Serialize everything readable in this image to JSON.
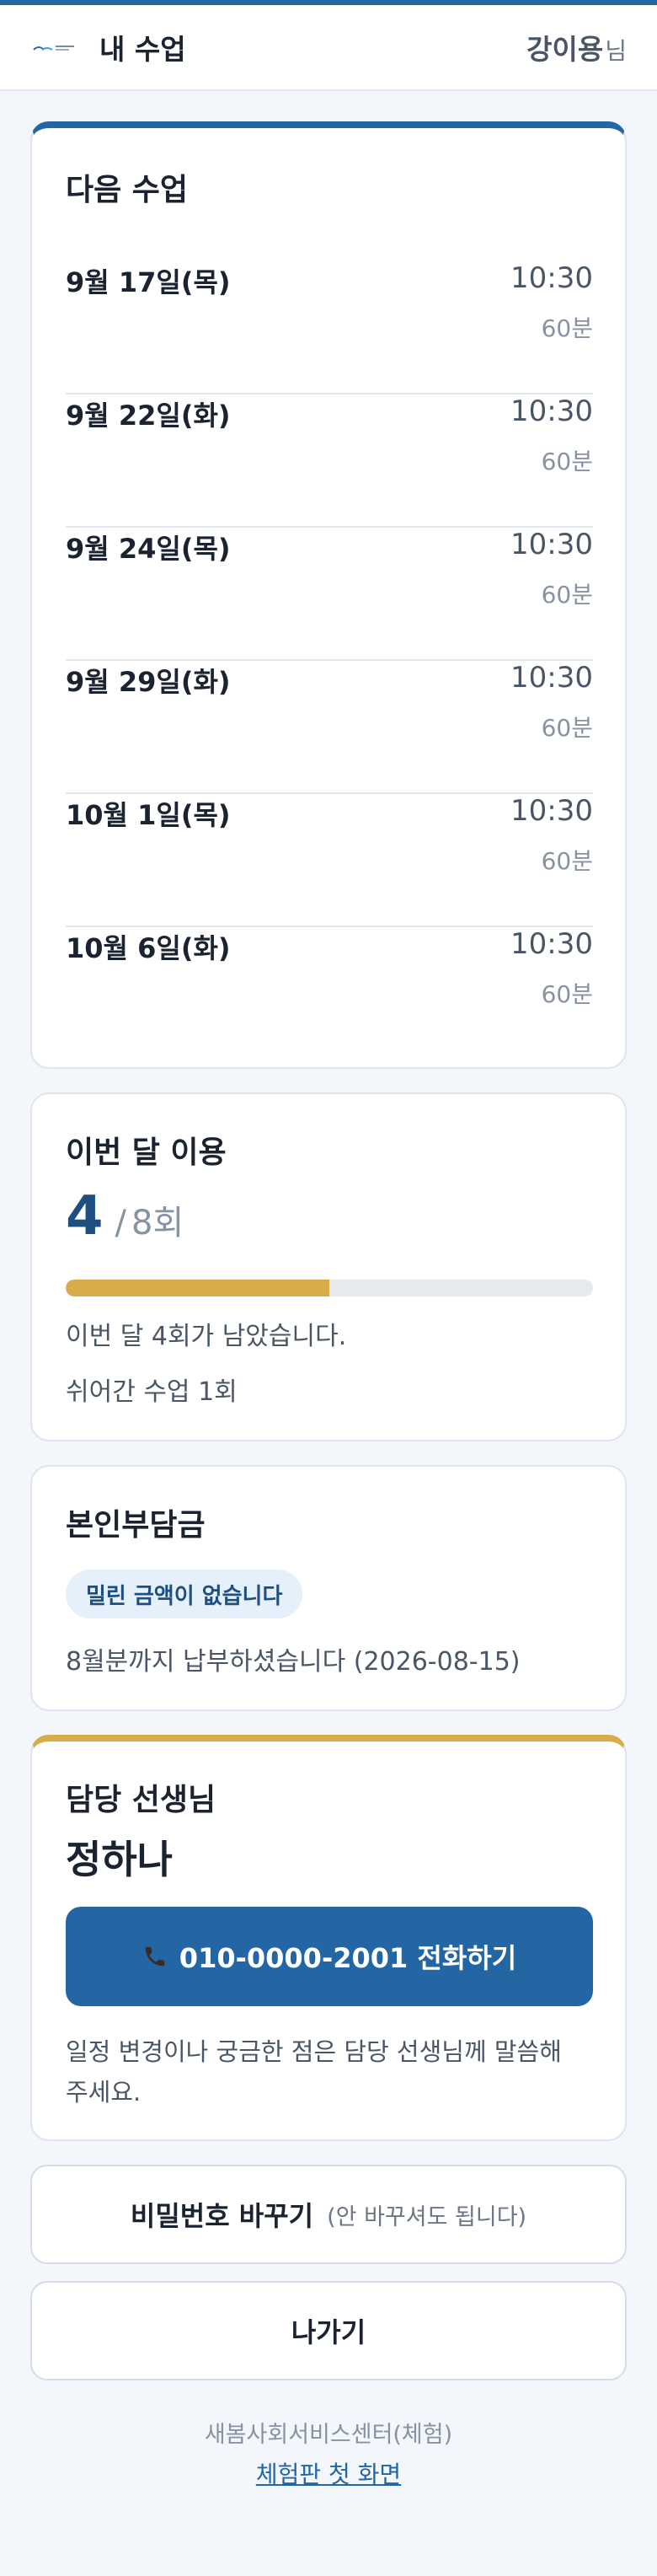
{
  "header": {
    "title": "내 수업",
    "user_name": "강이용",
    "user_suffix": "님",
    "logo_icon": "organization-logo-icon"
  },
  "next_classes": {
    "title": "다음 수업",
    "items": [
      {
        "date": "9월 17일(목)",
        "time": "10:30",
        "duration": "60분"
      },
      {
        "date": "9월 22일(화)",
        "time": "10:30",
        "duration": "60분"
      },
      {
        "date": "9월 24일(목)",
        "time": "10:30",
        "duration": "60분"
      },
      {
        "date": "9월 29일(화)",
        "time": "10:30",
        "duration": "60분"
      },
      {
        "date": "10월 1일(목)",
        "time": "10:30",
        "duration": "60분"
      },
      {
        "date": "10월 6일(화)",
        "time": "10:30",
        "duration": "60분"
      }
    ]
  },
  "usage": {
    "title": "이번 달 이용",
    "used": "4",
    "separator": "/",
    "total": "8회",
    "progress_fraction": 0.5,
    "remaining_text": "이번 달 4회가 남았습니다.",
    "skipped_text": "쉬어간 수업 1회"
  },
  "copay": {
    "title": "본인부담금",
    "badge": "밀린 금액이 없습니다",
    "paid_text": "8월분까지 납부하셨습니다 (2026-08-15)"
  },
  "teacher": {
    "title": "담당 선생님",
    "name": "정하나",
    "call_label": "010-0000-2001 전화하기",
    "call_icon": "phone-icon",
    "note": "일정 변경이나 궁금한 점은 담당 선생님께 말씀해 주세요."
  },
  "actions": {
    "change_password_label": "비밀번호 바꾸기",
    "change_password_note": "(안 바꾸셔도 됩니다)",
    "logout_label": "나가기"
  },
  "footer": {
    "org": "새봄사회서비스센터(체험)",
    "home_link": "체험판 첫 화면"
  },
  "colors": {
    "primary": "#2366a3",
    "accent_gold": "#d9ac4a",
    "badge_bg": "#e6f0fa"
  }
}
